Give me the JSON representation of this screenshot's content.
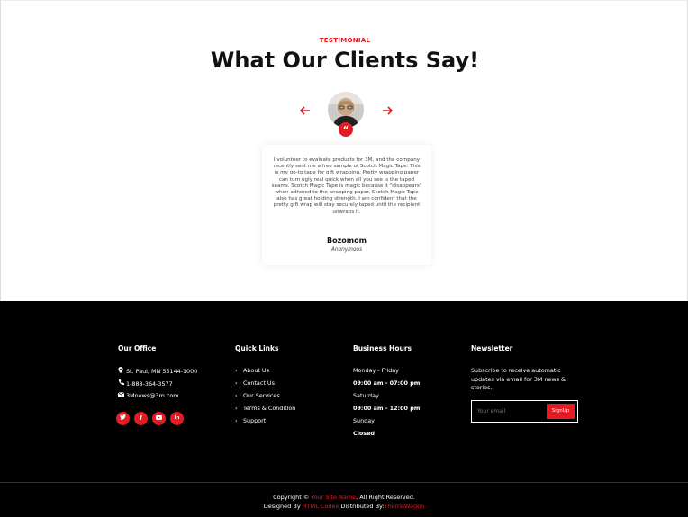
{
  "testimonial": {
    "eyebrow": "TESTIMONIAL",
    "title": "What Our Clients Say!",
    "prev_icon": "arrow-left-icon",
    "next_icon": "arrow-right-icon",
    "quote_icon": "quote-icon",
    "text": "I volunteer to evaluate products for 3M, and the company recently sent me a free sample of Scotch Magic Tape. This is my go-to tape for gift wrapping. Pretty wrapping paper can turn ugly real quick when all you see is the taped seams. Scotch Magic Tape is magic because it \"disappears\" when adhered to the wrapping paper. Scotch Magic Tape also has great holding strength. I am confident that the pretty gift wrap will stay securely taped until the recipient unwraps it.",
    "name": "Bozomom",
    "role": "Anonymous"
  },
  "footer": {
    "office": {
      "heading": "Our Office",
      "address": "St. Paul, MN 55144-1000",
      "phone": "1-888-364-3577",
      "email": "3Mnews@3m.com",
      "social": [
        "twitter-icon",
        "facebook-icon",
        "youtube-icon",
        "linkedin-icon"
      ]
    },
    "links": {
      "heading": "Quick Links",
      "items": [
        "About Us",
        "Contact Us",
        "Our Services",
        "Terms & Condition",
        "Support"
      ]
    },
    "hours": {
      "heading": "Business Hours",
      "lines": [
        "Monday - Friday",
        "09:00 am - 07:00 pm",
        "Saturday",
        "09:00 am - 12:00 pm",
        "Sunday",
        "Closed"
      ]
    },
    "newsletter": {
      "heading": "Newsletter",
      "text": "Subscribe to receive automatic updates via email for 3M news & stories.",
      "placeholder": "Your email",
      "button": "SignUp"
    },
    "copyright": {
      "prefix": "Copyright ©",
      "site": "Your Site Name",
      "suffix": ", All Right Reserved.",
      "designed_by": "Designed By",
      "designer": "HTML Codex",
      "distributed_by": "Distributed By:",
      "distributor": "ThemeWagon"
    }
  },
  "colors": {
    "accent": "#e31b23",
    "footer_bg": "#000000"
  }
}
